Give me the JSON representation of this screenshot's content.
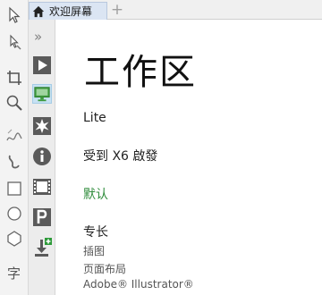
{
  "tab": {
    "label": "欢迎屏幕",
    "add_symbol": "+"
  },
  "dock": {
    "collapse_symbol": "»"
  },
  "workspace": {
    "title": "工作区",
    "edition": "Lite",
    "inspired_by": "受到 X6 啟發",
    "default": "默认",
    "specialty_heading": "专长",
    "specialties": [
      "插图",
      "页面布局",
      "Adobe® Illustrator®"
    ]
  },
  "toolbox": {
    "tools": [
      "pick-tool-icon",
      "shape-tool-icon",
      "crop-tool-icon",
      "zoom-tool-icon",
      "freehand-tool-icon",
      "artistic-media-tool-icon",
      "rectangle-tool-icon",
      "ellipse-tool-icon",
      "polygon-tool-icon",
      "text-tool-icon"
    ]
  },
  "dock_buttons": [
    "get-started-icon",
    "workspace-icon",
    "whats-new-icon",
    "info-icon",
    "gallery-icon",
    "get-more-icon",
    "updates-icon"
  ],
  "colors": {
    "accent": "#2e8b3a",
    "active_dock": "#c7e2f3",
    "tab_bg": "#dbe5f3"
  }
}
